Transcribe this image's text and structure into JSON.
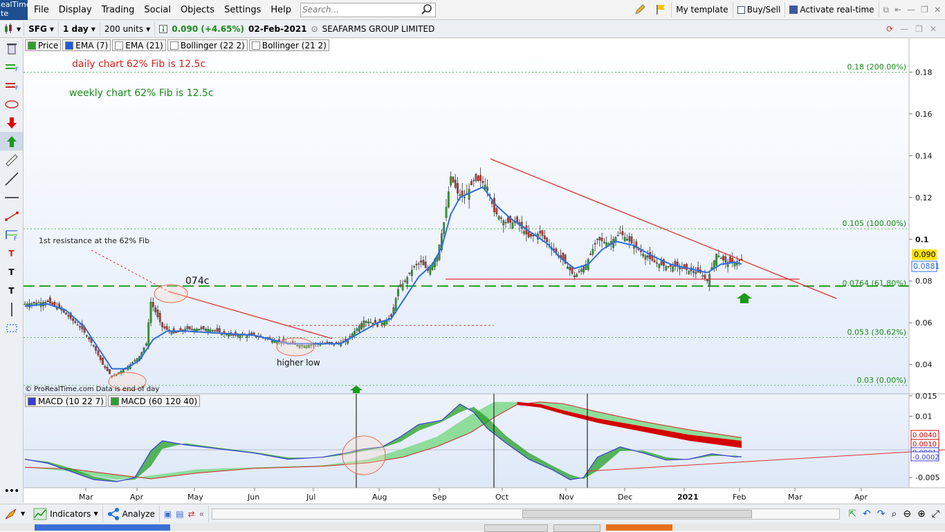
{
  "app": {
    "logo_line1": "ealTime",
    "logo_line2": "te"
  },
  "menu": [
    "File",
    "Display",
    "Trading",
    "Social",
    "Objects",
    "Settings",
    "Help"
  ],
  "search": {
    "placeholder": "Search..."
  },
  "toolbar_right": {
    "template_label": "My template",
    "buysell_label": "Buy/Sell",
    "realtime_label": "Activate real-time"
  },
  "symbolbar": {
    "ticker": "SFG",
    "interval": "1 day",
    "units": "200 units",
    "price_change": "0.090 (+4.65%)",
    "date": "02-Feb-2021",
    "company": "SEAFARMS GROUP LIMITED"
  },
  "legend": [
    {
      "label": "Price",
      "color": "#2ca02c"
    },
    {
      "label": "EMA (7)",
      "color": "#1f5bd6"
    },
    {
      "label": "EMA (21)",
      "color": "#ffffff"
    },
    {
      "label": "Bollinger (22 2)",
      "color": "#ffffff"
    },
    {
      "label": "Bollinger (21 2)",
      "color": "#ffffff"
    }
  ],
  "annotations": {
    "daily": "daily chart   62%  Fib is  12.5c",
    "weekly": "weekly chart 62%  Fib is  12.5c",
    "resistance": "1st resistance at the 62% Fib",
    "peak_label": "074c",
    "higher_low": "higher low",
    "copyright": "© ProRealTime.com  Data is end of day"
  },
  "fib_levels": [
    {
      "label": "0.18 (200.00%)",
      "value": 0.18
    },
    {
      "label": "0.105 (100.00%)",
      "value": 0.105
    },
    {
      "label": "0.0764 (61.80%)",
      "value": 0.0764
    },
    {
      "label": "0.053 (30.62%)",
      "value": 0.053
    },
    {
      "label": "0.03 (0.00%)",
      "value": 0.03
    }
  ],
  "price_badges": {
    "last": "0.090",
    "ema": "0.0881"
  },
  "macd_legend": [
    {
      "label": "MACD (10 22 7)",
      "color": "#3b3bd0"
    },
    {
      "label": "MACD (60 120 40)",
      "color": "#2ca02c"
    }
  ],
  "macd_badges": {
    "a": "0.0040",
    "b": "0.0010",
    "c": "0.0001",
    "d": "-0.0002"
  },
  "chart_data": [
    {
      "type": "candlestick",
      "title": "",
      "ylim": [
        0.026,
        0.196
      ],
      "y_ticks": [
        {
          "label": "0.18",
          "value": 0.18
        },
        {
          "label": "0.16",
          "value": 0.16
        },
        {
          "label": "0.14",
          "value": 0.14
        },
        {
          "label": "0.12",
          "value": 0.12
        },
        {
          "label": "0.1",
          "value": 0.1
        },
        {
          "label": "0.08",
          "value": 0.08
        },
        {
          "label": "0.06",
          "value": 0.06
        },
        {
          "label": "0.04",
          "value": 0.04
        }
      ],
      "x_ticks": [
        "Mar",
        "Apr",
        "May",
        "Jun",
        "Jul",
        "Aug",
        "Sep",
        "Oct",
        "Nov",
        "Dec",
        "2021",
        "Feb",
        "Mar",
        "Apr"
      ],
      "close_path": [
        [
          0,
          0.069
        ],
        [
          10,
          0.07
        ],
        [
          15,
          0.067
        ],
        [
          20,
          0.062
        ],
        [
          25,
          0.057
        ],
        [
          30,
          0.049
        ],
        [
          34,
          0.04
        ],
        [
          38,
          0.034
        ],
        [
          42,
          0.037
        ],
        [
          46,
          0.04
        ],
        [
          50,
          0.044
        ],
        [
          53,
          0.05
        ],
        [
          55,
          0.07
        ],
        [
          60,
          0.058
        ],
        [
          65,
          0.055
        ],
        [
          70,
          0.057
        ],
        [
          80,
          0.057
        ],
        [
          90,
          0.054
        ],
        [
          100,
          0.054
        ],
        [
          108,
          0.052
        ],
        [
          115,
          0.05
        ],
        [
          122,
          0.049
        ],
        [
          128,
          0.05
        ],
        [
          135,
          0.05
        ],
        [
          140,
          0.051
        ],
        [
          144,
          0.056
        ],
        [
          148,
          0.061
        ],
        [
          152,
          0.06
        ],
        [
          156,
          0.06
        ],
        [
          160,
          0.063
        ],
        [
          163,
          0.076
        ],
        [
          166,
          0.08
        ],
        [
          170,
          0.087
        ],
        [
          173,
          0.089
        ],
        [
          176,
          0.085
        ],
        [
          180,
          0.092
        ],
        [
          183,
          0.108
        ],
        [
          186,
          0.13
        ],
        [
          189,
          0.122
        ],
        [
          192,
          0.12
        ],
        [
          196,
          0.128
        ],
        [
          199,
          0.128
        ],
        [
          202,
          0.125
        ],
        [
          205,
          0.113
        ],
        [
          210,
          0.108
        ],
        [
          215,
          0.108
        ],
        [
          220,
          0.101
        ],
        [
          225,
          0.103
        ],
        [
          230,
          0.096
        ],
        [
          235,
          0.09
        ],
        [
          240,
          0.082
        ],
        [
          245,
          0.088
        ],
        [
          250,
          0.1
        ],
        [
          255,
          0.098
        ],
        [
          260,
          0.103
        ],
        [
          265,
          0.098
        ],
        [
          270,
          0.093
        ],
        [
          275,
          0.089
        ],
        [
          280,
          0.087
        ],
        [
          285,
          0.087
        ],
        [
          290,
          0.085
        ],
        [
          295,
          0.084
        ],
        [
          298,
          0.08
        ],
        [
          302,
          0.093
        ],
        [
          306,
          0.089
        ],
        [
          310,
          0.089
        ],
        [
          313,
          0.09
        ]
      ],
      "ema7_path": [
        [
          0,
          0.068
        ],
        [
          10,
          0.069
        ],
        [
          18,
          0.066
        ],
        [
          26,
          0.058
        ],
        [
          32,
          0.048
        ],
        [
          38,
          0.038
        ],
        [
          44,
          0.038
        ],
        [
          50,
          0.042
        ],
        [
          56,
          0.052
        ],
        [
          62,
          0.056
        ],
        [
          70,
          0.056
        ],
        [
          85,
          0.055
        ],
        [
          100,
          0.054
        ],
        [
          115,
          0.05
        ],
        [
          128,
          0.05
        ],
        [
          138,
          0.05
        ],
        [
          146,
          0.055
        ],
        [
          154,
          0.06
        ],
        [
          160,
          0.062
        ],
        [
          166,
          0.072
        ],
        [
          172,
          0.082
        ],
        [
          178,
          0.088
        ],
        [
          182,
          0.096
        ],
        [
          186,
          0.112
        ],
        [
          190,
          0.12
        ],
        [
          196,
          0.123
        ],
        [
          200,
          0.125
        ],
        [
          206,
          0.116
        ],
        [
          212,
          0.11
        ],
        [
          220,
          0.104
        ],
        [
          228,
          0.098
        ],
        [
          234,
          0.091
        ],
        [
          240,
          0.086
        ],
        [
          246,
          0.088
        ],
        [
          252,
          0.095
        ],
        [
          258,
          0.099
        ],
        [
          266,
          0.097
        ],
        [
          274,
          0.092
        ],
        [
          282,
          0.088
        ],
        [
          290,
          0.086
        ],
        [
          298,
          0.084
        ],
        [
          304,
          0.088
        ],
        [
          310,
          0.089
        ],
        [
          313,
          0.0881
        ]
      ]
    },
    {
      "type": "line",
      "title": "",
      "ylim": [
        -0.0075,
        0.0155
      ],
      "y_ticks": [
        {
          "label": "0.015",
          "value": 0.015
        },
        {
          "label": "0.01",
          "value": 0.01
        },
        {
          "label": "-0.005",
          "value": -0.005
        }
      ],
      "series": [
        {
          "name": "MACD (10 22 7)",
          "values": [
            [
              0,
              -0.0005
            ],
            [
              10,
              -0.0015
            ],
            [
              20,
              -0.0035
            ],
            [
              30,
              -0.0055
            ],
            [
              40,
              -0.006
            ],
            [
              48,
              -0.005
            ],
            [
              55,
              0.0015
            ],
            [
              60,
              0.004
            ],
            [
              70,
              0.003
            ],
            [
              85,
              0.002
            ],
            [
              100,
              0.001
            ],
            [
              115,
              -0.0005
            ],
            [
              130,
              0.0
            ],
            [
              140,
              0.001
            ],
            [
              148,
              0.002
            ],
            [
              156,
              0.0025
            ],
            [
              164,
              0.005
            ],
            [
              172,
              0.008
            ],
            [
              182,
              0.009
            ],
            [
              190,
              0.013
            ],
            [
              196,
              0.011
            ],
            [
              202,
              0.007
            ],
            [
              210,
              0.0035
            ],
            [
              220,
              -0.0005
            ],
            [
              230,
              -0.003
            ],
            [
              238,
              -0.0055
            ],
            [
              244,
              -0.005
            ],
            [
              250,
              0.0
            ],
            [
              260,
              0.0025
            ],
            [
              270,
              0.001
            ],
            [
              280,
              -0.0007
            ],
            [
              290,
              -0.0005
            ],
            [
              300,
              0.0008
            ],
            [
              310,
              0.0001
            ],
            [
              313,
              0.0001
            ]
          ]
        },
        {
          "name": "MACD (60 120 40)",
          "values": [
            [
              0,
              -0.0025
            ],
            [
              20,
              -0.0035
            ],
            [
              40,
              -0.0055
            ],
            [
              55,
              -0.0045
            ],
            [
              75,
              -0.003
            ],
            [
              100,
              -0.0025
            ],
            [
              130,
              -0.002
            ],
            [
              150,
              -0.0005
            ],
            [
              165,
              0.002
            ],
            [
              180,
              0.005
            ],
            [
              195,
              0.0105
            ],
            [
              205,
              0.0135
            ],
            [
              215,
              0.0135
            ],
            [
              225,
              0.013
            ],
            [
              235,
              0.0115
            ],
            [
              250,
              0.0095
            ],
            [
              270,
              0.0075
            ],
            [
              290,
              0.0055
            ],
            [
              313,
              0.004
            ]
          ]
        }
      ]
    }
  ],
  "bottom": {
    "indicators_label": "Indicators",
    "analyze_label": "Analyze"
  }
}
